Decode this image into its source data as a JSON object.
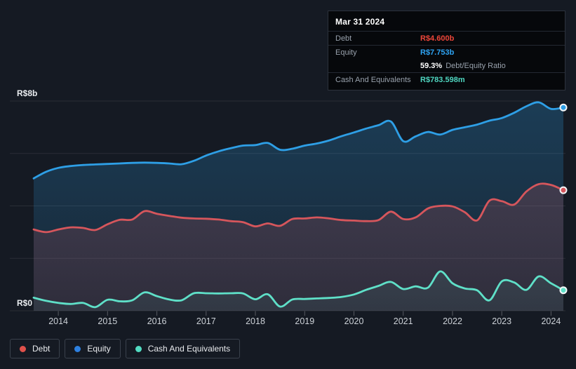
{
  "colors": {
    "debt": "#e0514b",
    "equity_dot": "#2d80e0",
    "cash": "#52dcc2",
    "debt_text": "#ee4639",
    "equity_text": "#2ea4f4",
    "cash_text": "#4fd6c0",
    "background": "#151a23"
  },
  "tooltip": {
    "date": "Mar 31 2024",
    "debt_label": "Debt",
    "debt_value": "R$4.600b",
    "equity_label": "Equity",
    "equity_value": "R$7.753b",
    "ratio_value": "59.3%",
    "ratio_label": "Debt/Equity Ratio",
    "cash_label": "Cash And Equivalents",
    "cash_value": "R$783.598m"
  },
  "legend": {
    "items": [
      {
        "label": "Debt"
      },
      {
        "label": "Equity"
      },
      {
        "label": "Cash And Equivalents"
      }
    ]
  },
  "chart_data": {
    "type": "area",
    "unit": "R$ billions",
    "xlim": [
      2013.5,
      2024.25
    ],
    "ylim": [
      0,
      8
    ],
    "y_gridlines": [
      0,
      2,
      4,
      6,
      8
    ],
    "y_labels": [
      {
        "v": 8,
        "label": "R$8b"
      },
      {
        "v": 0,
        "label": "R$0"
      }
    ],
    "x_ticks": [
      {
        "v": 2014,
        "label": "2014"
      },
      {
        "v": 2015,
        "label": "2015"
      },
      {
        "v": 2016,
        "label": "2016"
      },
      {
        "v": 2017,
        "label": "2017"
      },
      {
        "v": 2018,
        "label": "2018"
      },
      {
        "v": 2019,
        "label": "2019"
      },
      {
        "v": 2020,
        "label": "2020"
      },
      {
        "v": 2021,
        "label": "2021"
      },
      {
        "v": 2022,
        "label": "2022"
      },
      {
        "v": 2023,
        "label": "2023"
      },
      {
        "v": 2024,
        "label": "2024"
      }
    ],
    "x": [
      2013.5,
      2013.75,
      2014,
      2014.25,
      2014.5,
      2014.75,
      2015,
      2015.25,
      2015.5,
      2015.75,
      2016,
      2016.25,
      2016.5,
      2016.75,
      2017,
      2017.25,
      2017.5,
      2017.75,
      2018,
      2018.25,
      2018.5,
      2018.75,
      2019,
      2019.25,
      2019.5,
      2019.75,
      2020,
      2020.25,
      2020.5,
      2020.75,
      2021,
      2021.25,
      2021.5,
      2021.75,
      2022,
      2022.25,
      2022.5,
      2022.75,
      2023,
      2023.25,
      2023.5,
      2023.75,
      2024,
      2024.25
    ],
    "series": [
      {
        "name": "Debt",
        "color": "#d6565c",
        "values": [
          3.1,
          3.0,
          3.1,
          3.18,
          3.16,
          3.08,
          3.3,
          3.47,
          3.48,
          3.8,
          3.7,
          3.62,
          3.55,
          3.52,
          3.51,
          3.48,
          3.42,
          3.38,
          3.22,
          3.33,
          3.24,
          3.5,
          3.52,
          3.56,
          3.52,
          3.46,
          3.44,
          3.42,
          3.46,
          3.78,
          3.5,
          3.56,
          3.9,
          4.0,
          3.98,
          3.76,
          3.45,
          4.2,
          4.18,
          4.05,
          4.55,
          4.83,
          4.8,
          4.6
        ]
      },
      {
        "name": "Equity",
        "color": "#2e9fe6",
        "values": [
          5.05,
          5.3,
          5.45,
          5.52,
          5.56,
          5.58,
          5.6,
          5.62,
          5.64,
          5.65,
          5.64,
          5.62,
          5.59,
          5.72,
          5.92,
          6.08,
          6.2,
          6.3,
          6.32,
          6.4,
          6.14,
          6.18,
          6.3,
          6.38,
          6.5,
          6.66,
          6.8,
          6.95,
          7.08,
          7.22,
          6.47,
          6.65,
          6.82,
          6.72,
          6.9,
          7.0,
          7.1,
          7.25,
          7.35,
          7.55,
          7.8,
          7.95,
          7.7,
          7.753
        ]
      },
      {
        "name": "Cash And Equivalents",
        "color": "#5fe0c8",
        "values": [
          0.5,
          0.38,
          0.3,
          0.26,
          0.3,
          0.14,
          0.42,
          0.36,
          0.4,
          0.7,
          0.56,
          0.43,
          0.4,
          0.67,
          0.67,
          0.66,
          0.67,
          0.66,
          0.44,
          0.63,
          0.16,
          0.43,
          0.45,
          0.47,
          0.49,
          0.53,
          0.62,
          0.8,
          0.95,
          1.1,
          0.83,
          0.93,
          0.88,
          1.5,
          1.05,
          0.85,
          0.78,
          0.4,
          1.12,
          1.08,
          0.8,
          1.31,
          1.05,
          0.784
        ]
      }
    ]
  }
}
